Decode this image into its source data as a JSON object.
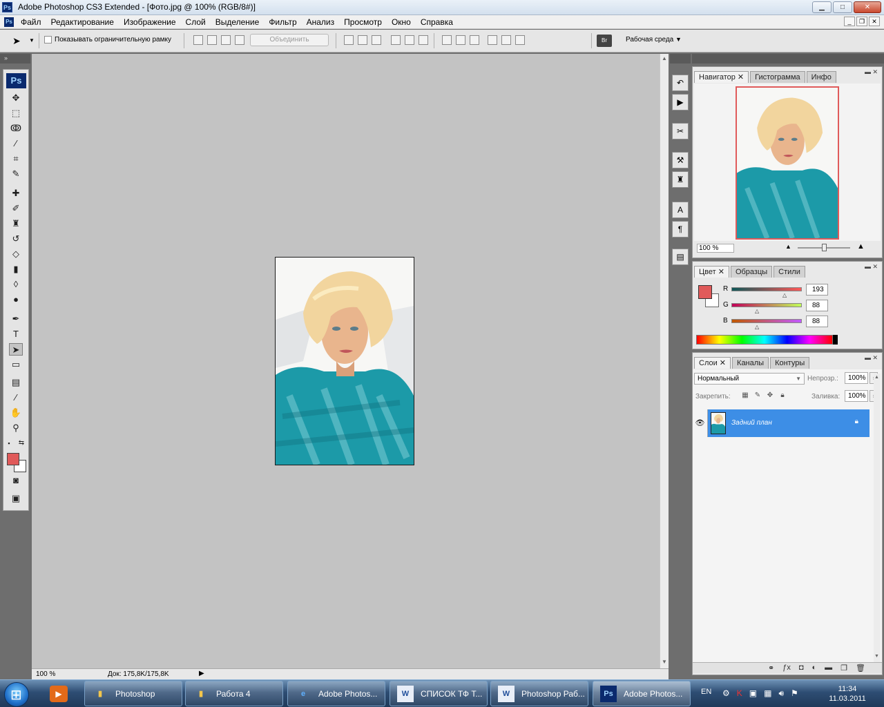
{
  "window": {
    "title": "Adobe Photoshop CS3 Extended - [Фото.jpg @ 100% (RGB/8#)]",
    "app_icon": "Ps"
  },
  "menu": {
    "items": [
      "Файл",
      "Редактирование",
      "Изображение",
      "Слой",
      "Выделение",
      "Фильтр",
      "Анализ",
      "Просмотр",
      "Окно",
      "Справка"
    ]
  },
  "options": {
    "show_bounds_label": "Показывать ограничительную рамку",
    "combine_label": "Объединить",
    "workspace_label": "Рабочая среда",
    "bridge_icon_text": "Br"
  },
  "toolbox": {
    "badge": "Ps"
  },
  "status": {
    "zoom": "100 %",
    "doc_info": "Док: 175,8K/175,8K"
  },
  "navigator": {
    "tabs": [
      "Навигатор",
      "Гистограмма",
      "Инфо"
    ],
    "zoom": "100 %"
  },
  "color": {
    "tabs": [
      "Цвет",
      "Образцы",
      "Стили"
    ],
    "r_label": "R",
    "g_label": "G",
    "b_label": "B",
    "r": 193,
    "g": 88,
    "b": 88,
    "foreground_hex": "#e05a5a"
  },
  "layers": {
    "tabs": [
      "Слои",
      "Каналы",
      "Контуры"
    ],
    "blend_mode": "Нормальный",
    "opacity_label": "Непрозр.:",
    "opacity_value": "100%",
    "lock_label": "Закрепить:",
    "fill_label": "Заливка:",
    "fill_value": "100%",
    "layer_name": "Задний план"
  },
  "taskbar": {
    "tasks": [
      "Photoshop",
      "Работа 4",
      "Adobe Photos...",
      "СПИСОК ТФ Т...",
      "Photoshop Раб...",
      "Adobe Photos..."
    ],
    "language": "EN",
    "time": "11:34",
    "date": "11.03.2011"
  },
  "colors": {
    "selection_blue": "#3d8ee6",
    "canvas_gray": "#c3c3c3",
    "accent_red": "#e05a5a"
  }
}
